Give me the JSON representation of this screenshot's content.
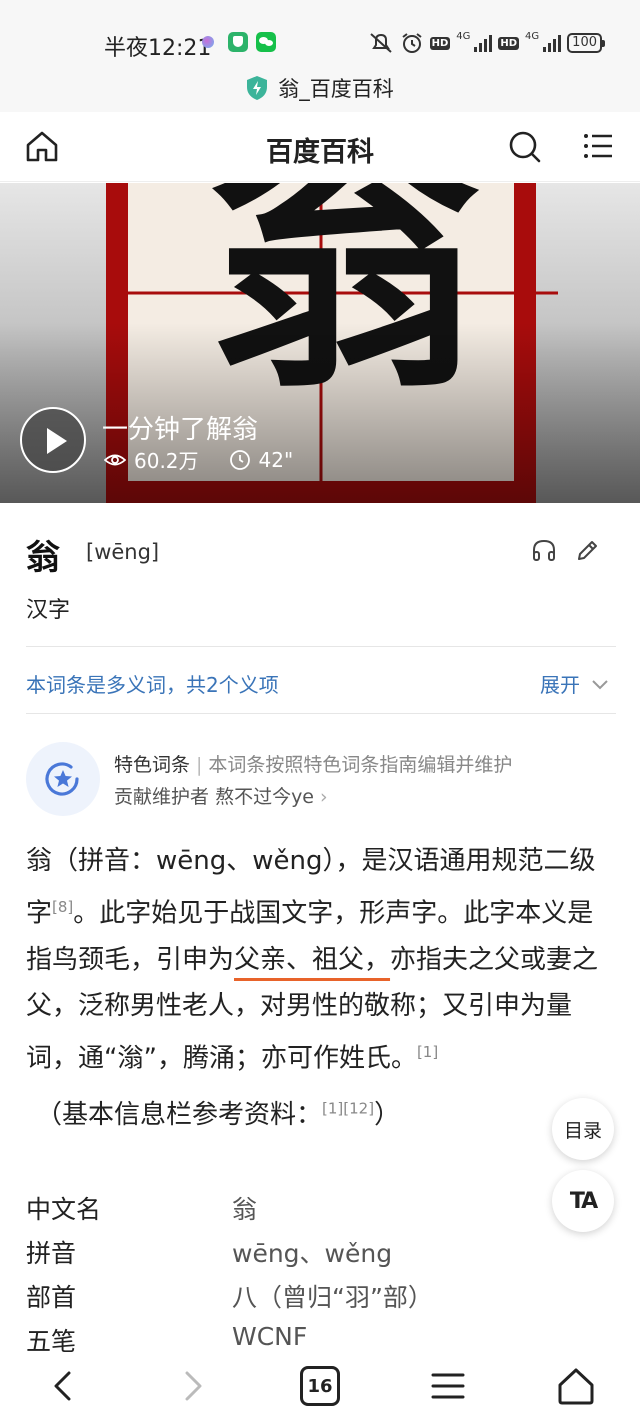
{
  "status_bar": {
    "time": "半夜12:21",
    "battery": "100",
    "network": "4G",
    "hd": "HD"
  },
  "url_bar": {
    "page_title": "翁_百度百科"
  },
  "header": {
    "title": "百度百科"
  },
  "video": {
    "character": "翁",
    "title": "一分钟了解翁",
    "views": "60.2万",
    "duration": "42\""
  },
  "entry": {
    "character": "翁",
    "pinyin": "[wēng]",
    "type": "汉字"
  },
  "polysemy": {
    "text": "本词条是多义词，共2个义项",
    "expand_label": "展开"
  },
  "featured": {
    "label": "特色词条",
    "description": "本词条按照特色词条指南编辑并维护",
    "contributor_prefix": "贡献维护者",
    "contributor_name": "熬不过今ye"
  },
  "paragraph": {
    "part1": "翁（拼音：wēng、wěng），是汉语通用规范二级字",
    "ref1": "[8]",
    "part2": "。此字始见于战国文字，形声字。此字本义是指鸟颈毛，引申为",
    "highlight": "父亲、祖父，",
    "part3": "亦指夫之父或妻之父，泛称男性老人，对男性的敬称；又引申为量词，通“滃”，腾涌；亦可作姓氏。",
    "ref2": "[1]"
  },
  "ref_note": {
    "prefix": "（基本信息栏参考资料：",
    "refs": "[1][12]",
    "suffix": "）"
  },
  "floating": {
    "toc_label": "目录",
    "text_size_label": "TA"
  },
  "info_table": [
    {
      "key": "中文名",
      "value": "翁"
    },
    {
      "key": "拼音",
      "value": "wēng、wěng"
    },
    {
      "key": "部首",
      "value": "八（曾归“羽”部）"
    },
    {
      "key": "五笔",
      "value": "WCNF"
    }
  ],
  "bottom_nav": {
    "tab_count": "16"
  },
  "colors": {
    "link_blue": "#3a74b8",
    "underline_orange": "#e8632a",
    "tile_red": "#a80c0c"
  }
}
